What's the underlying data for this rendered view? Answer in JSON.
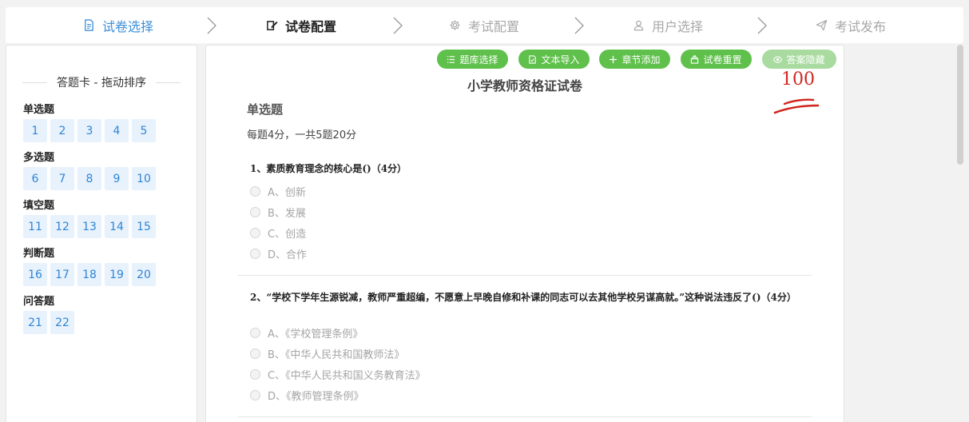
{
  "stepper": {
    "steps": [
      {
        "label": "试卷选择",
        "icon": "document-icon",
        "state": "done"
      },
      {
        "label": "试卷配置",
        "icon": "edit-icon",
        "state": "active"
      },
      {
        "label": "考试配置",
        "icon": "gear-icon",
        "state": "pending"
      },
      {
        "label": "用户选择",
        "icon": "user-icon",
        "state": "pending"
      },
      {
        "label": "考试发布",
        "icon": "send-icon",
        "state": "pending"
      }
    ]
  },
  "answer_card": {
    "title": "答题卡 - 拖动排序",
    "groups": [
      {
        "label": "单选题",
        "items": [
          "1",
          "2",
          "3",
          "4",
          "5"
        ]
      },
      {
        "label": "多选题",
        "items": [
          "6",
          "7",
          "8",
          "9",
          "10"
        ]
      },
      {
        "label": "填空题",
        "items": [
          "11",
          "12",
          "13",
          "14",
          "15"
        ]
      },
      {
        "label": "判断题",
        "items": [
          "16",
          "17",
          "18",
          "19",
          "20"
        ]
      },
      {
        "label": "问答题",
        "items": [
          "21",
          "22"
        ]
      }
    ]
  },
  "toolbar": {
    "question_bank": "题库选择",
    "text_import": "文本导入",
    "add_chapter": "章节添加",
    "reset_paper": "试卷重置",
    "hide_answers": "答案隐藏"
  },
  "paper": {
    "title": "小学教师资格证试卷",
    "score": "100",
    "section": {
      "title": "单选题",
      "desc": "每题4分，一共5题20分"
    },
    "questions": [
      {
        "stem": "1、素质教育理念的核心是()（4分）",
        "options": [
          "A、创新",
          "B、发展",
          "C、创造",
          "D、合作"
        ]
      },
      {
        "stem": "2、“学校下学年生源锐减，教师严重超编，不愿意上早晚自修和补课的同志可以去其他学校另谋高就。”这种说法违反了()（4分）",
        "options": [
          "A、《学校管理条例》",
          "B、《中华人民共和国教师法》",
          "C、《中华人民共和国义务教育法》",
          "D、《教师管理条例》"
        ]
      }
    ]
  },
  "colors": {
    "accent_blue": "#3d8fd8",
    "button_green": "#5fc04b",
    "score_red": "#d0261e"
  }
}
